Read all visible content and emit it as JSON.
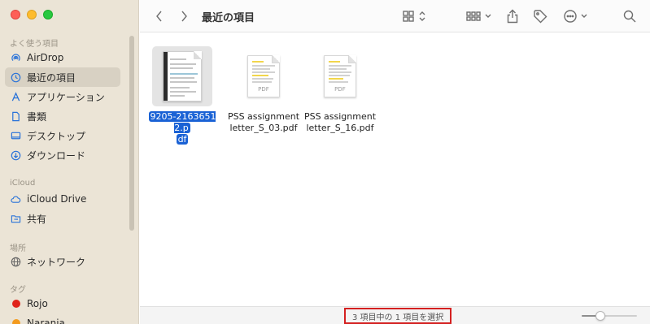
{
  "window": {
    "title": "最近の項目"
  },
  "sidebar": {
    "sections": [
      {
        "header": "よく使う項目",
        "items": [
          {
            "label": "AirDrop",
            "icon": "airdrop-icon",
            "selected": false
          },
          {
            "label": "最近の項目",
            "icon": "clock-icon",
            "selected": true
          },
          {
            "label": "アプリケーション",
            "icon": "applications-icon",
            "selected": false
          },
          {
            "label": "書類",
            "icon": "document-icon",
            "selected": false
          },
          {
            "label": "デスクトップ",
            "icon": "desktop-icon",
            "selected": false
          },
          {
            "label": "ダウンロード",
            "icon": "download-icon",
            "selected": false
          }
        ]
      },
      {
        "header": "iCloud",
        "items": [
          {
            "label": "iCloud Drive",
            "icon": "cloud-icon",
            "selected": false
          },
          {
            "label": "共有",
            "icon": "shared-folder-icon",
            "selected": false
          }
        ]
      },
      {
        "header": "場所",
        "items": [
          {
            "label": "ネットワーク",
            "icon": "globe-icon",
            "selected": false
          }
        ]
      },
      {
        "header": "タグ",
        "items": [
          {
            "label": "Rojo",
            "icon": "tag-dot-icon",
            "color": "#e0241b",
            "selected": false
          },
          {
            "label": "Naranja",
            "icon": "tag-dot-icon",
            "color": "#f39a1d",
            "selected": false
          }
        ]
      }
    ]
  },
  "toolbar": {
    "back": "chevron-left-icon",
    "forward": "chevron-right-icon",
    "view": "grid-view-icon",
    "group": "group-icon",
    "share": "share-icon",
    "tag": "tag-icon",
    "more": "ellipsis-icon",
    "search": "search-icon"
  },
  "files": [
    {
      "name": "9205-21636512.pdf",
      "name_lines": [
        "9205-21636512.p",
        "df"
      ],
      "thumbnail": "invoice",
      "selected": true
    },
    {
      "name": "PSS assignment letter_S_03.pdf",
      "name_lines": [
        "PSS assignment",
        "letter_S_03.pdf"
      ],
      "thumbnail": "pdf",
      "badge": "PDF",
      "selected": false
    },
    {
      "name": "PSS assignment letter_S_16.pdf",
      "name_lines": [
        "PSS assignment",
        "letter_S_16.pdf"
      ],
      "thumbnail": "pdf",
      "badge": "PDF",
      "selected": false
    }
  ],
  "status": {
    "text": "3 項目中の 1 項目を選択",
    "icon_size": 0.3,
    "highlight_color": "#d42020"
  },
  "colors": {
    "selection": "#1a62d5",
    "sidebar_bg": "#ebe4d6"
  }
}
